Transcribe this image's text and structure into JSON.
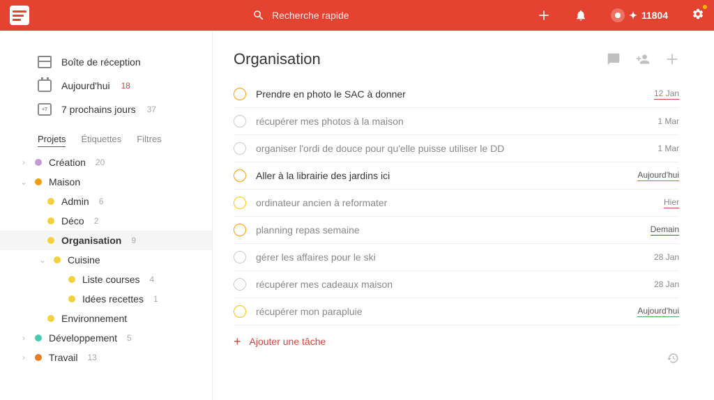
{
  "topbar": {
    "search_placeholder": "Recherche rapide",
    "karma": "11804"
  },
  "sidebar": {
    "inbox": {
      "label": "Boîte de réception"
    },
    "today": {
      "label": "Aujourd'hui",
      "count": "18"
    },
    "week": {
      "label": "7 prochains jours",
      "count": "37",
      "badge": "+7"
    },
    "tabs": {
      "projects": "Projets",
      "labels": "Étiquettes",
      "filters": "Filtres"
    },
    "projects": [
      {
        "name": "Création",
        "count": "20",
        "color": "#c39bd3",
        "chev": "›",
        "depth": 0
      },
      {
        "name": "Maison",
        "count": "",
        "color": "#f39c12",
        "chev": "⌄",
        "depth": 0
      },
      {
        "name": "Admin",
        "count": "6",
        "color": "#f4d03f",
        "depth": 1
      },
      {
        "name": "Déco",
        "count": "2",
        "color": "#f4d03f",
        "depth": 1
      },
      {
        "name": "Organisation",
        "count": "9",
        "color": "#f4d03f",
        "depth": 1,
        "selected": true
      },
      {
        "name": "Cuisine",
        "count": "",
        "color": "#f4d03f",
        "chev": "⌄",
        "depth": 1,
        "chevpos": true
      },
      {
        "name": "Liste courses",
        "count": "4",
        "color": "#f4d03f",
        "depth": 2
      },
      {
        "name": "Idées recettes",
        "count": "1",
        "color": "#f4d03f",
        "depth": 2
      },
      {
        "name": "Environnement",
        "count": "",
        "color": "#f4d03f",
        "depth": 1
      },
      {
        "name": "Développement",
        "count": "5",
        "color": "#48c9b0",
        "chev": "›",
        "depth": 0
      },
      {
        "name": "Travail",
        "count": "13",
        "color": "#e67e22",
        "chev": "›",
        "depth": 0
      }
    ]
  },
  "main": {
    "title": "Organisation",
    "add_task": "Ajouter une tâche",
    "tasks": [
      {
        "title": "Prendre en photo le SAC à donner",
        "date": "12 Jan",
        "priority": "p2",
        "date_style": "ul-red"
      },
      {
        "title": "récupérer mes photos à la maison",
        "date": "1 Mar",
        "priority": "",
        "grey": true
      },
      {
        "title": "organiser l'ordi de douce pour qu'elle puisse utiliser le DD",
        "date": "1 Mar",
        "priority": "",
        "grey": true
      },
      {
        "title": "Aller à la librairie des jardins ici",
        "date": "Aujourd'hui",
        "priority": "p2",
        "date_style": "ul-green"
      },
      {
        "title": "ordinateur ancien à reformater",
        "date": "Hier",
        "priority": "p3",
        "grey": true,
        "date_style": "ul-red"
      },
      {
        "title": "planning repas semaine",
        "date": "Demain",
        "priority": "p2",
        "grey": true,
        "date_style": "ul-blue"
      },
      {
        "title": "gérer les affaires pour le ski",
        "date": "28 Jan",
        "priority": "",
        "grey": true
      },
      {
        "title": "récupérer mes cadeaux maison",
        "date": "28 Jan",
        "priority": "",
        "grey": true
      },
      {
        "title": "récupérer mon parapluie",
        "date": "Aujourd'hui",
        "priority": "p3",
        "grey": true,
        "date_style": "ul-green"
      }
    ]
  }
}
